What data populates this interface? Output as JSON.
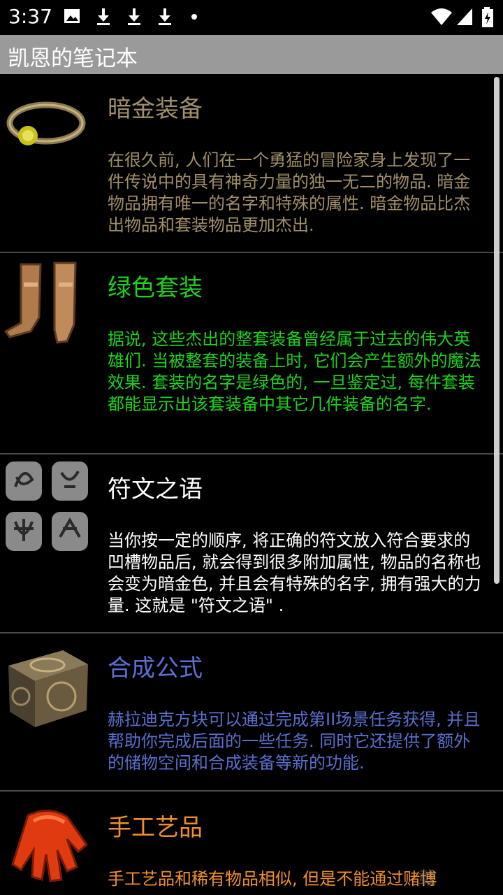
{
  "status_bar": {
    "time": "3:37"
  },
  "app_bar": {
    "title": "凯恩的笔记本"
  },
  "items": [
    {
      "title": "暗金装备",
      "description": "在很久前, 人们在一个勇猛的冒险家身上发现了一件传说中的具有神奇力量的独一无二的物品. 暗金物品拥有唯一的名字和特殊的属性. 暗金物品比杰出物品和套装物品更加杰出.",
      "color": "#a28e6a",
      "icon": "unique-ring-icon"
    },
    {
      "title": "绿色套装",
      "description": "据说, 这些杰出的整套装备曾经属于过去的伟大英雄们. 当被整套的装备上时, 它们会产生额外的魔法效果. 套装的名字是绿色的, 一旦鉴定过, 每件套装都能显示出该套装备中其它几件装备的名字.",
      "color": "#1ed11e",
      "icon": "set-boots-icon"
    },
    {
      "title": "符文之语",
      "description": "当你按一定的顺序, 将正确的符文放入符合要求的凹槽物品后, 就会得到很多附加属性, 物品的名称也会变为暗金色, 并且会有特殊的名字, 拥有强大的力量. 这就是 \"符文之语\" .",
      "color": "#ffffff",
      "icon": "runes-icon"
    },
    {
      "title": "合成公式",
      "description": "赫拉迪克方块可以通过完成第II场景任务获得, 并且帮助你完成后面的一些任务. 同时它还提供了额外的储物空间和合成装备等新的功能.",
      "color": "#5a6fd0",
      "icon": "horadric-cube-icon"
    },
    {
      "title": "手工艺品",
      "description": "手工艺品和稀有物品相似, 但是不能通过赌博",
      "color": "#f0902a",
      "icon": "crafted-gloves-icon"
    }
  ],
  "watermark": "载"
}
